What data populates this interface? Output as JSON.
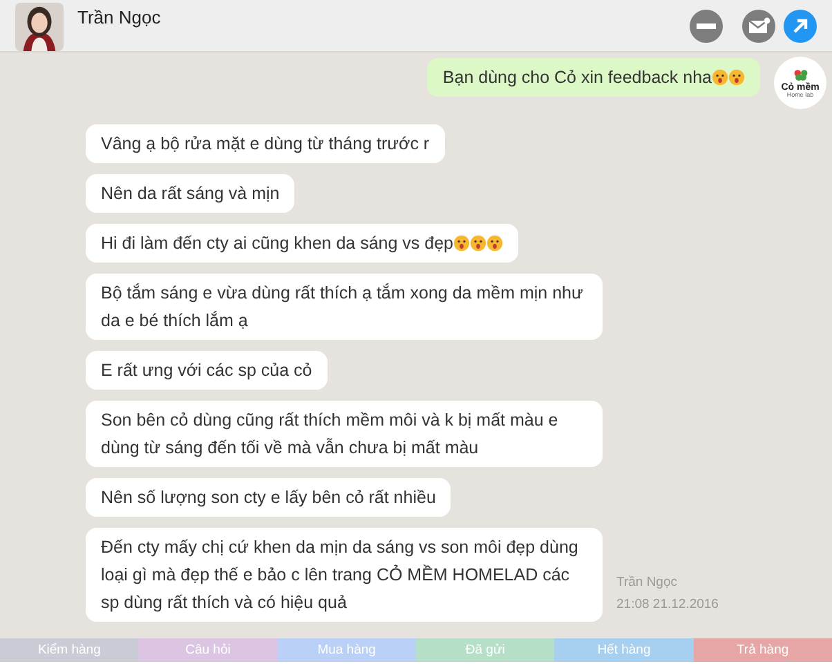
{
  "header": {
    "contact_name": "Trần Ngọc"
  },
  "outgoing": {
    "text": "Bạn dùng cho Cỏ xin feedback nha",
    "reactions": [
      {
        "kind": "wow"
      },
      {
        "kind": "wow"
      }
    ],
    "logo_text": "Cỏ mềm",
    "logo_subtext": "Home lab"
  },
  "messages": [
    {
      "text": "Vâng ạ bộ rửa mặt e dùng từ tháng trước r"
    },
    {
      "text": "Nên da rất sáng và mịn"
    },
    {
      "text": "Hi đi làm đến cty ai cũng khen da sáng vs đẹp",
      "reactions": [
        {
          "kind": "wow"
        },
        {
          "kind": "wow"
        },
        {
          "kind": "wow"
        }
      ]
    },
    {
      "text": "Bộ tắm sáng e vừa dùng rất thích ạ tắm xong da mềm mịn như da e bé thích lắm ạ"
    },
    {
      "text": "E rất ưng với các sp của cỏ"
    },
    {
      "text": "Son bên cỏ dùng cũng rất thích mềm môi và k bị mất màu e dùng từ sáng đến tối về mà vẫn chưa bị mất màu"
    },
    {
      "text": "Nên số lượng son cty e lấy bên cỏ rất nhiều"
    },
    {
      "text": "Đến cty mấy chị cứ khen da mịn da sáng vs son môi đẹp dùng loại gì mà đẹp thế e bảo c lên trang CỎ MỀM HOMELAD các sp dùng rất thích và có hiệu quả",
      "sender": "Trần Ngọc",
      "time": "21:08 21.12.2016"
    }
  ],
  "labels": [
    {
      "text": "Kiểm hàng",
      "color": "#c9ccd5"
    },
    {
      "text": "Câu hỏi",
      "color": "#dcc5e3"
    },
    {
      "text": "Mua hàng",
      "color": "#bad0f6"
    },
    {
      "text": "Đã gửi",
      "color": "#b5dfc6"
    },
    {
      "text": "Hết hàng",
      "color": "#a6cff0"
    },
    {
      "text": "Trả hàng",
      "color": "#e6a6a6"
    }
  ]
}
